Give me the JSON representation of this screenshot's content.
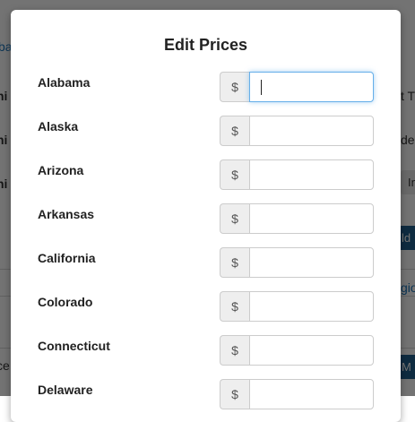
{
  "background": {
    "frag_left": [
      "ba",
      "ni",
      "ni",
      "ni",
      "ce"
    ],
    "frag_right": [
      "t T",
      "de",
      "In",
      "ld",
      "gio",
      "M"
    ]
  },
  "modal": {
    "title": "Edit Prices",
    "currency_symbol": "$",
    "states": [
      {
        "name": "Alabama",
        "value": ""
      },
      {
        "name": "Alaska",
        "value": ""
      },
      {
        "name": "Arizona",
        "value": ""
      },
      {
        "name": "Arkansas",
        "value": ""
      },
      {
        "name": "California",
        "value": ""
      },
      {
        "name": "Colorado",
        "value": ""
      },
      {
        "name": "Connecticut",
        "value": ""
      },
      {
        "name": "Delaware",
        "value": ""
      }
    ],
    "focused_state": "Alabama"
  }
}
